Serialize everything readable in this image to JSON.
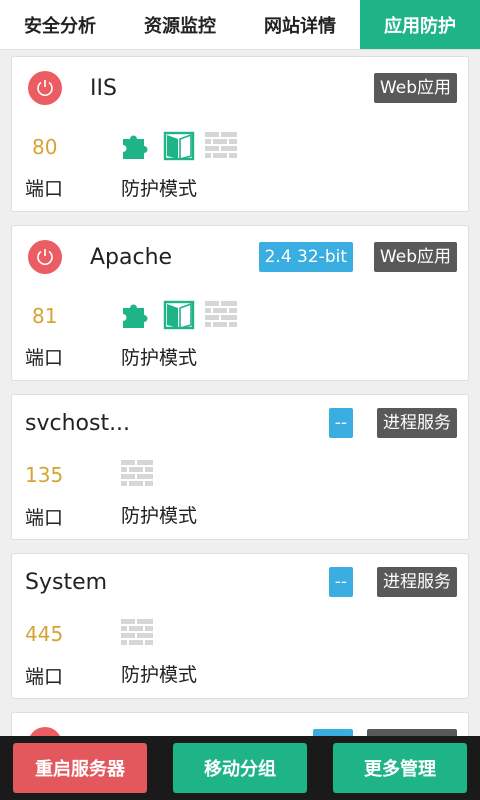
{
  "tabs": [
    {
      "label": "安全分析",
      "active": false
    },
    {
      "label": "资源监控",
      "active": false
    },
    {
      "label": "网站详情",
      "active": false
    },
    {
      "label": "应用防护",
      "active": true
    }
  ],
  "colors": {
    "accent_green": "#1fb488",
    "power_red": "#ea5d62",
    "port_gold": "#d5a435",
    "badge_gray": "#595959",
    "badge_blue": "#3aaee0"
  },
  "cards": [
    {
      "name": "IIS",
      "has_power_icon": true,
      "version_badge": "",
      "type_badge": "Web应用",
      "port": "80",
      "port_label": "端口",
      "mode_label": "防护模式",
      "mode_icons": [
        "puzzle-icon",
        "door-icon",
        "firewall-icon"
      ]
    },
    {
      "name": "Apache",
      "has_power_icon": true,
      "version_badge": "2.4 32-bit",
      "type_badge": "Web应用",
      "port": "81",
      "port_label": "端口",
      "mode_label": "防护模式",
      "mode_icons": [
        "puzzle-icon",
        "door-icon",
        "firewall-icon"
      ]
    },
    {
      "name": "svchost...",
      "has_power_icon": false,
      "version_badge": "--",
      "type_badge": "进程服务",
      "port": "135",
      "port_label": "端口",
      "mode_label": "防护模式",
      "mode_icons": [
        "firewall-icon"
      ]
    },
    {
      "name": "System",
      "has_power_icon": false,
      "version_badge": "--",
      "type_badge": "进程服务",
      "port": "445",
      "port_label": "端口",
      "mode_label": "防护模式",
      "mode_icons": [
        "firewall-icon"
      ]
    }
  ],
  "bottom_buttons": {
    "restart": "重启服务器",
    "move_group": "移动分组",
    "more_manage": "更多管理"
  }
}
